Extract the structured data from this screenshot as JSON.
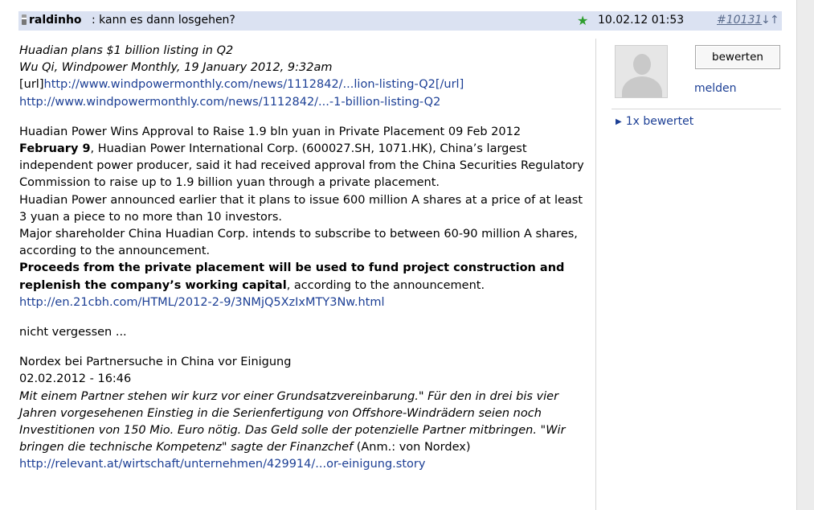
{
  "header": {
    "username": "raldinho",
    "title": ": kann es dann losgehen?",
    "timestamp": "10.02.12 01:53",
    "post_number": "#10131",
    "arrow_down": "↓",
    "arrow_up": "↑",
    "star": "★"
  },
  "body": {
    "p1": "Huadian plans $1 billion listing in Q2",
    "p2": "Wu Qi, Windpower Monthly, 19 January 2012, 9:32am",
    "p3_prefix": "[url]",
    "p3_link": "http://www.windpowermonthly.com/news/1112842/...lion-listing-Q2[/url]",
    "p4_link": "http://www.windpowermonthly.com/news/1112842/...-1-billion-listing-Q2",
    "p5": "Huadian Power Wins Approval to Raise 1.9 bln yuan in Private Placement 09 Feb 2012",
    "p6_bold": "February 9",
    "p6": ", Huadian Power International Corp. (600027.SH, 1071.HK), China’s largest independent power producer, said it had received approval from the China Securities Regulatory Commission to raise up to 1.9 billion yuan through a private placement.",
    "p7": "Huadian Power announced earlier that it plans to issue 600 million A shares at a price of at least 3 yuan a piece to no more than 10 investors.",
    "p8": "Major shareholder China Huadian Corp. intends to subscribe to between 60-90 million A shares, according to the announcement.",
    "p9_bold": "Proceeds from the private placement will be used to fund project construction and replenish the company’s working capital",
    "p9": ", according to the announcement.",
    "p10_link": "http://en.21cbh.com/HTML/2012-2-9/3NMjQ5XzIxMTY3Nw.html",
    "p11": "nicht vergessen ...",
    "p12": "Nordex bei Partnersuche in China vor Einigung",
    "p13": "02.02.2012 - 16:46",
    "p14_italic": "Mit einem Partner stehen wir kurz vor einer Grundsatzvereinbarung.\" Für den in drei bis vier Jahren vorgesehenen Einstieg in die Serienfertigung von Offshore-Windrädern seien noch Investitionen von 150 Mio. Euro nötig. Das Geld solle der potenzielle Partner mitbringen. \"Wir bringen die technische Kompetenz\" sagte der Finanzchef ",
    "p14_plain": "(Anm.: von Nordex)",
    "p15_link": "http://relevant.at/wirtschaft/unternehmen/429914/...or-einigung.story"
  },
  "sidebar": {
    "rate_button": "bewerten",
    "report_link": "melden",
    "ratings_link": "1x bewertet"
  },
  "colors": {
    "header_bg": "#dbe2f2",
    "link": "#1c3f95",
    "star": "#2e9e2e"
  }
}
